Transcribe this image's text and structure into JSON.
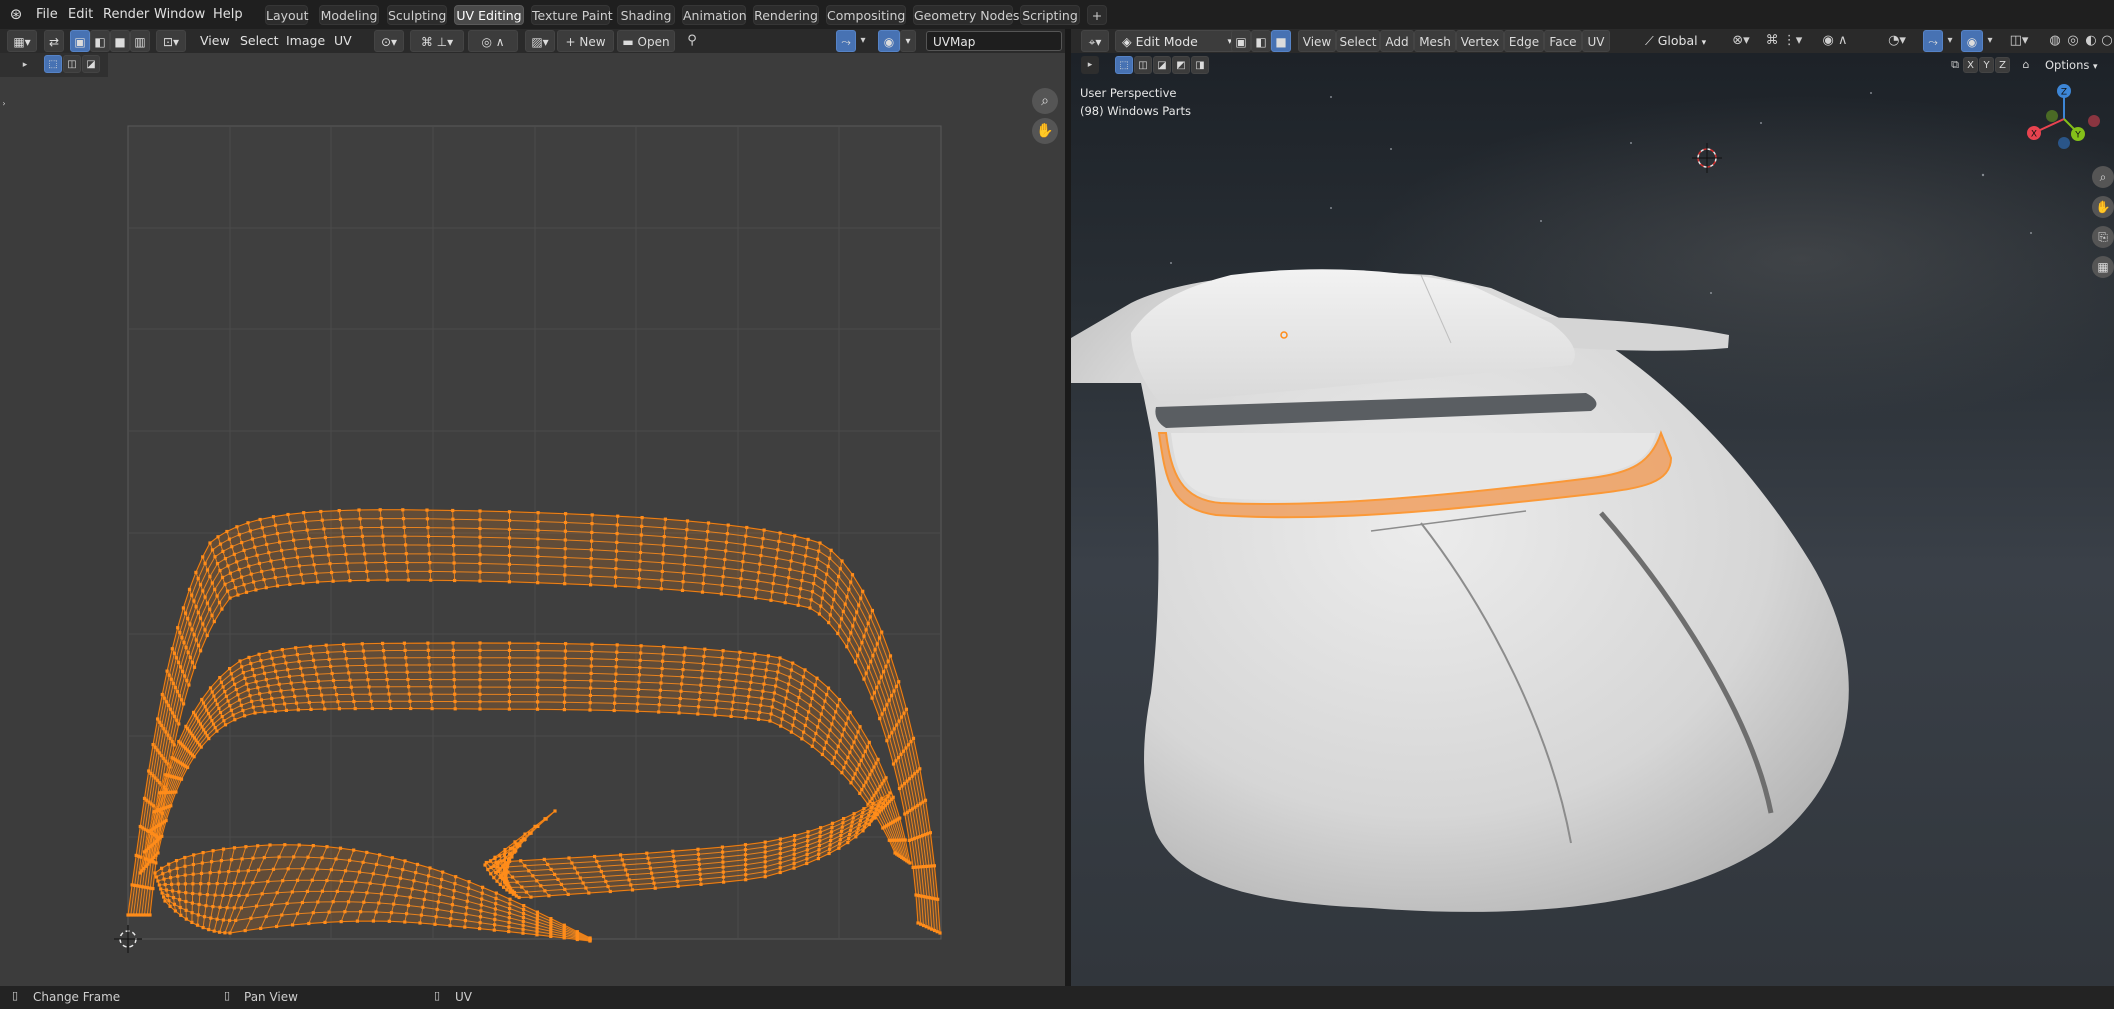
{
  "app": {
    "name": "Blender"
  },
  "menu": {
    "file": "File",
    "edit": "Edit",
    "render": "Render",
    "window": "Window",
    "help": "Help"
  },
  "workspaces": [
    "Layout",
    "Modeling",
    "Sculpting",
    "UV Editing",
    "Texture Paint",
    "Shading",
    "Animation",
    "Rendering",
    "Compositing",
    "Geometry Nodes",
    "Scripting"
  ],
  "active_workspace": "UV Editing",
  "add_workspace": "+",
  "uv_editor": {
    "menus": {
      "view": "View",
      "select": "Select",
      "image": "Image",
      "uv": "UV"
    },
    "new_label": "New",
    "open_label": "Open",
    "uvmap_field": "UVMap"
  },
  "viewport": {
    "mode": "Edit Mode",
    "menus": {
      "view": "View",
      "select": "Select",
      "add": "Add",
      "mesh": "Mesh",
      "vertex": "Vertex",
      "edge": "Edge",
      "face": "Face",
      "uv": "UV"
    },
    "orientation": "Global",
    "options_label": "Options",
    "axis_x": "X",
    "axis_y": "Y",
    "axis_z": "Z",
    "perspective_label": "User Perspective",
    "object_label": "(98) Windows Parts",
    "gizmo": {
      "x": "X",
      "y": "Y",
      "z": "Z"
    }
  },
  "status_bar": {
    "item1": "Change Frame",
    "item2": "Pan View",
    "item3": "UV"
  },
  "colors": {
    "accent_blue": "#4772b3",
    "uv_orange": "#ff8c1a",
    "uv_edge_dark": "#8a4a10",
    "axis_x": "#e8434f",
    "axis_y": "#84c019",
    "axis_z": "#3d86d6"
  },
  "icons": [
    "blender-logo-icon",
    "editor-type-icon",
    "sync-selection-icon",
    "vertex-select-icon",
    "edge-select-icon",
    "face-select-icon",
    "island-select-icon",
    "pivot-icon",
    "snap-icon",
    "proportional-icon",
    "pin-icon",
    "zoom-icon",
    "hand-icon",
    "camera-icon",
    "grid-icon",
    "cursor-icon"
  ]
}
